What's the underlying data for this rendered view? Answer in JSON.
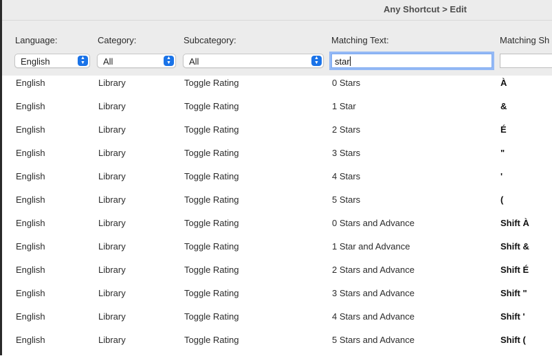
{
  "window": {
    "title": "Any Shortcut > Edit"
  },
  "filters": {
    "language": {
      "label": "Language:",
      "value": "English"
    },
    "category": {
      "label": "Category:",
      "value": "All"
    },
    "subcategory": {
      "label": "Subcategory:",
      "value": "All"
    },
    "matching_text": {
      "label": "Matching Text:",
      "value": "star"
    },
    "matching_shortcut": {
      "label": "Matching Sh",
      "value": ""
    }
  },
  "rows": [
    {
      "language": "English",
      "category": "Library",
      "subcategory": "Toggle Rating",
      "text": "0 Stars",
      "shortcut": "À"
    },
    {
      "language": "English",
      "category": "Library",
      "subcategory": "Toggle Rating",
      "text": "1 Star",
      "shortcut": "&"
    },
    {
      "language": "English",
      "category": "Library",
      "subcategory": "Toggle Rating",
      "text": "2 Stars",
      "shortcut": "É"
    },
    {
      "language": "English",
      "category": "Library",
      "subcategory": "Toggle Rating",
      "text": "3 Stars",
      "shortcut": "\""
    },
    {
      "language": "English",
      "category": "Library",
      "subcategory": "Toggle Rating",
      "text": "4 Stars",
      "shortcut": "'"
    },
    {
      "language": "English",
      "category": "Library",
      "subcategory": "Toggle Rating",
      "text": "5 Stars",
      "shortcut": "("
    },
    {
      "language": "English",
      "category": "Library",
      "subcategory": "Toggle Rating",
      "text": "0 Stars and Advance",
      "shortcut": "Shift À"
    },
    {
      "language": "English",
      "category": "Library",
      "subcategory": "Toggle Rating",
      "text": "1 Star and Advance",
      "shortcut": "Shift &"
    },
    {
      "language": "English",
      "category": "Library",
      "subcategory": "Toggle Rating",
      "text": "2 Stars and Advance",
      "shortcut": "Shift É"
    },
    {
      "language": "English",
      "category": "Library",
      "subcategory": "Toggle Rating",
      "text": "3 Stars and Advance",
      "shortcut": "Shift \""
    },
    {
      "language": "English",
      "category": "Library",
      "subcategory": "Toggle Rating",
      "text": "4 Stars and Advance",
      "shortcut": "Shift '"
    },
    {
      "language": "English",
      "category": "Library",
      "subcategory": "Toggle Rating",
      "text": "5 Stars and Advance",
      "shortcut": "Shift ("
    }
  ],
  "colors": {
    "accent": "#1a73e8",
    "panel": "#ececec",
    "focus_ring": "#4d90fe"
  },
  "icons": {
    "select_arrows": "chevron-up-down-icon"
  }
}
